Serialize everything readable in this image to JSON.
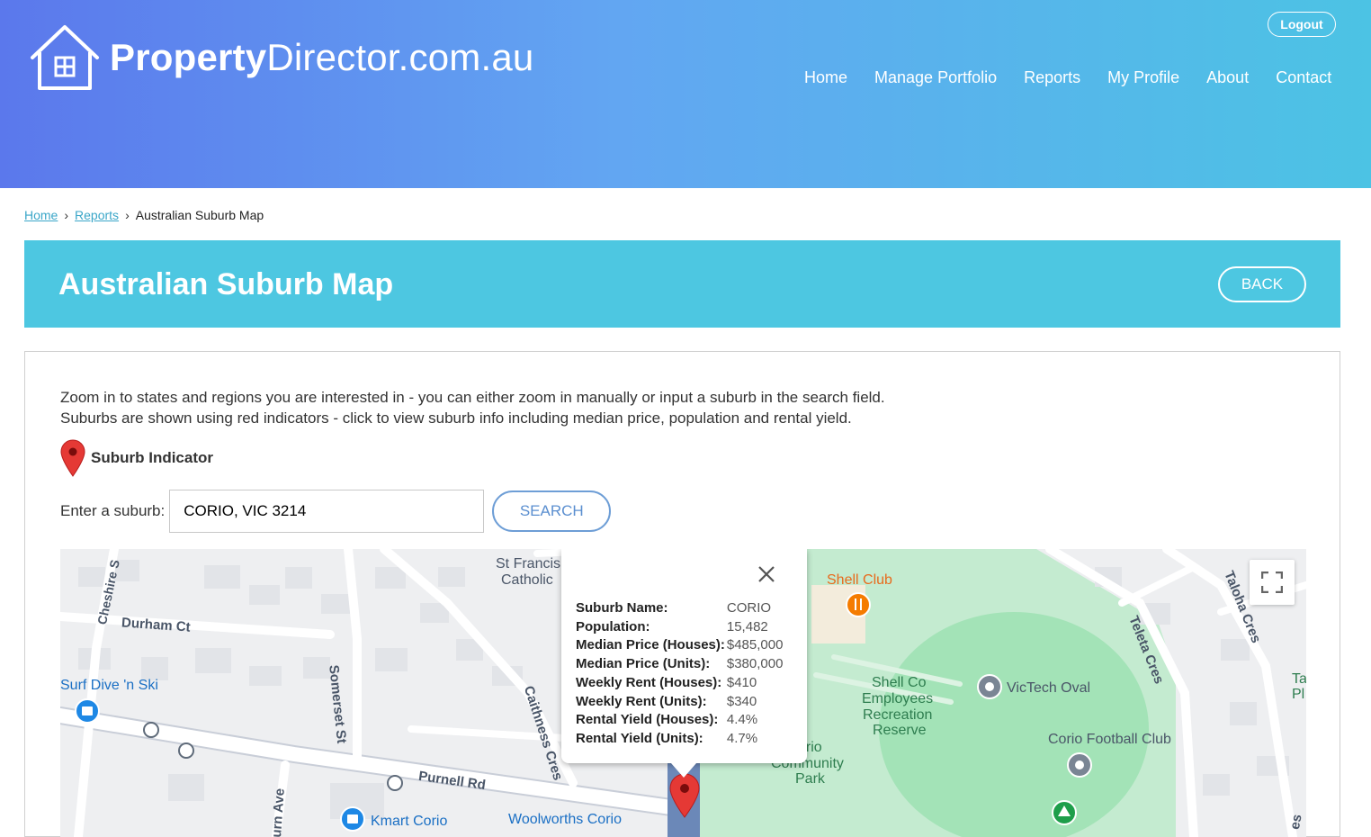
{
  "header": {
    "logo_bold": "Property",
    "logo_light": "Director.com.au",
    "logout_label": "Logout",
    "nav": [
      {
        "label": "Home"
      },
      {
        "label": "Manage Portfolio"
      },
      {
        "label": "Reports"
      },
      {
        "label": "My Profile"
      },
      {
        "label": "About"
      },
      {
        "label": "Contact"
      }
    ]
  },
  "breadcrumb": {
    "home": "Home",
    "reports": "Reports",
    "current": "Australian Suburb Map"
  },
  "banner": {
    "title": "Australian Suburb Map",
    "back_label": "BACK"
  },
  "content": {
    "intro_line1": "Zoom in to states and regions you are interested in - you can either zoom in manually or input a suburb in the search field.",
    "intro_line2": "Suburbs are shown using red indicators - click to view suburb info including median price, population and rental yield.",
    "indicator_label": "Suburb Indicator",
    "search_label": "Enter a suburb:",
    "search_value": "CORIO, VIC 3214",
    "search_button": "SEARCH"
  },
  "map": {
    "labels": {
      "st_francis": "St Francis",
      "catholic": "Catholic",
      "shell_club": "Shell Club",
      "cheshire": "Cheshire S",
      "durham": "Durham Ct",
      "surf_dive": "Surf Dive 'n Ski",
      "somerset": "Somerset St",
      "caithness": "Caithness Cres",
      "purnell": "Purnell Rd",
      "urn_ave": "urn Ave",
      "kmart": "Kmart Corio",
      "woolworths": "Woolworths Corio",
      "shell_co": "Shell Co",
      "employees": "Employees",
      "recreation": "Recreation",
      "reserve": "Reserve",
      "victech": "VicTech Oval",
      "teleta": "Teleta Cres",
      "taloha": "Taloha Cres",
      "corio_football": "Corio Football Club",
      "corio_park_1": "orio",
      "corio_park_2": "Community",
      "corio_park_3": "Park",
      "ta": "Ta",
      "pl": "Pl",
      "es": "es"
    },
    "info": {
      "rows": [
        {
          "key": "Suburb Name:",
          "value": "CORIO"
        },
        {
          "key": "Population:",
          "value": "15,482"
        },
        {
          "key": "Median Price (Houses):",
          "value": "$485,000"
        },
        {
          "key": "Median Price (Units):",
          "value": "$380,000"
        },
        {
          "key": "Weekly Rent (Houses):",
          "value": "$410"
        },
        {
          "key": "Weekly Rent (Units):",
          "value": "$340"
        },
        {
          "key": "Rental Yield (Houses):",
          "value": "4.4%"
        },
        {
          "key": "Rental Yield (Units):",
          "value": "4.7%"
        }
      ]
    }
  },
  "colors": {
    "banner": "#4dc7e1",
    "marker": "#e53935",
    "park": "#b8e8c8",
    "oval": "#9fe3b3"
  }
}
